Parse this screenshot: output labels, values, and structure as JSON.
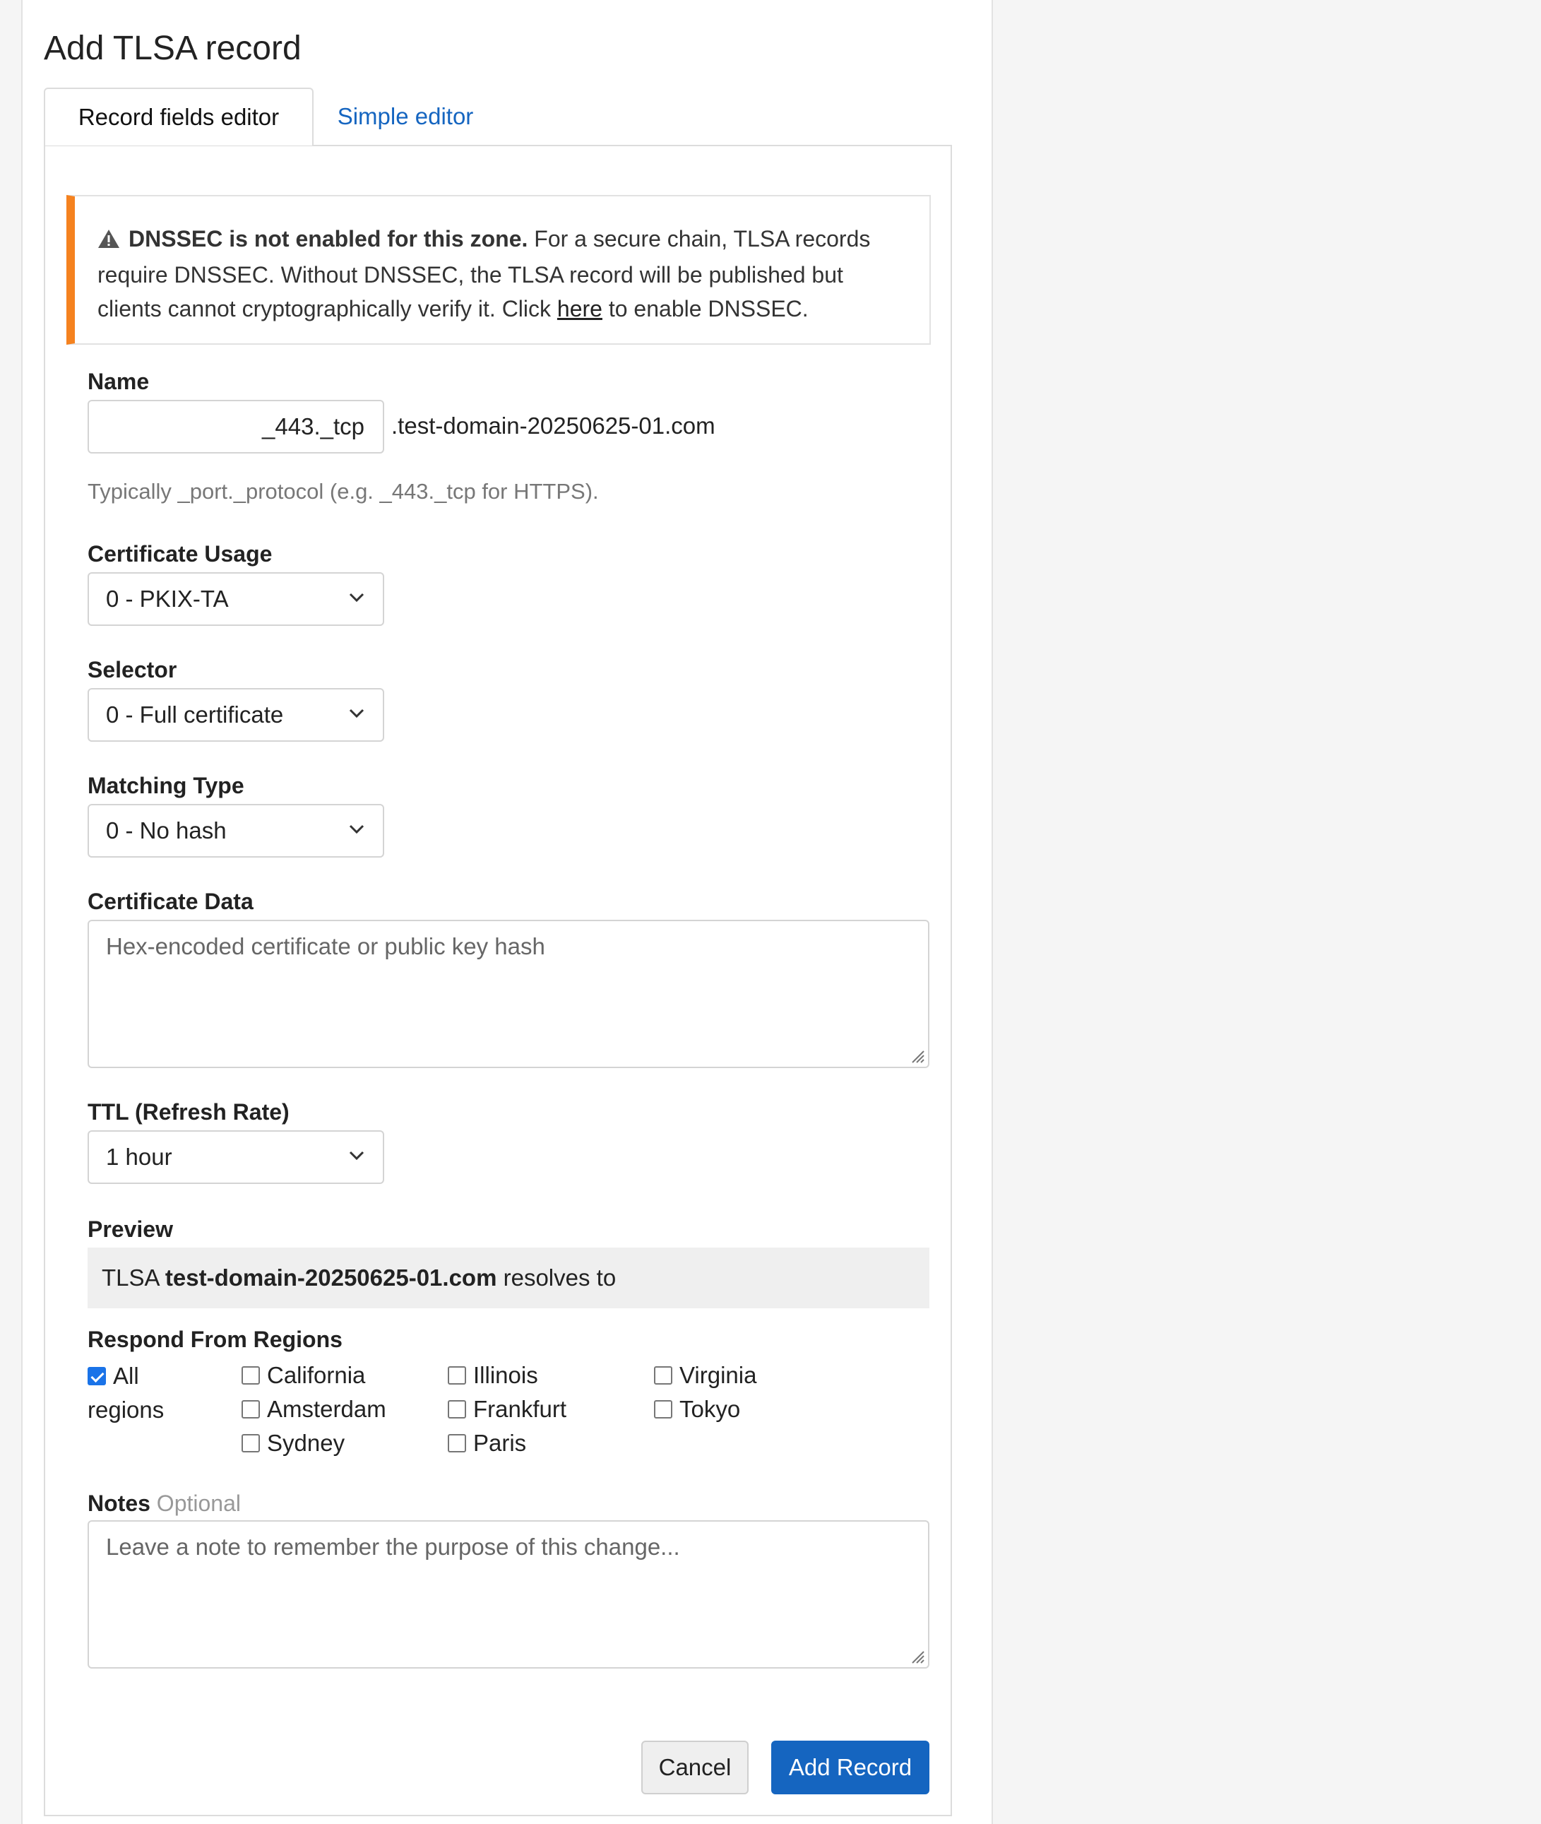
{
  "title": "Add TLSA record",
  "tabs": {
    "active": "Record fields editor",
    "simple": "Simple editor"
  },
  "warning": {
    "bold": "DNSSEC is not enabled for this zone.",
    "text_before_link": " For a secure chain, TLSA records require DNSSEC. Without DNSSEC, the TLSA record will be published but clients cannot cryptographically verify it. Click ",
    "link": "here",
    "text_after_link": " to enable DNSSEC.",
    "accent_color": "#f5821f"
  },
  "name": {
    "label": "Name",
    "value": "_443._tcp",
    "suffix": ".test-domain-20250625-01.com",
    "help": "Typically _port._protocol (e.g. _443._tcp for HTTPS)."
  },
  "certificate_usage": {
    "label": "Certificate Usage",
    "selected": "0 - PKIX-TA"
  },
  "selector": {
    "label": "Selector",
    "selected": "0 - Full certificate"
  },
  "matching_type": {
    "label": "Matching Type",
    "selected": "0 - No hash"
  },
  "certificate_data": {
    "label": "Certificate Data",
    "placeholder": "Hex-encoded certificate or public key hash"
  },
  "ttl": {
    "label": "TTL (Refresh Rate)",
    "selected": "1 hour"
  },
  "preview": {
    "label": "Preview",
    "prefix": "TLSA",
    "domain": "test-domain-20250625-01.com",
    "suffix": "resolves to"
  },
  "regions": {
    "label": "Respond From Regions",
    "all_line1": "All",
    "all_line2": "regions",
    "all_checked": true,
    "items": [
      "California",
      "Amsterdam",
      "Sydney",
      "Illinois",
      "Frankfurt",
      "Paris",
      "Virginia",
      "Tokyo"
    ]
  },
  "notes": {
    "label": "Notes",
    "optional": "Optional",
    "placeholder": "Leave a note to remember the purpose of this change..."
  },
  "buttons": {
    "cancel": "Cancel",
    "add": "Add Record"
  },
  "colors": {
    "primary": "#1565c0",
    "link": "#1565c0",
    "checkbox": "#1a73e8"
  }
}
